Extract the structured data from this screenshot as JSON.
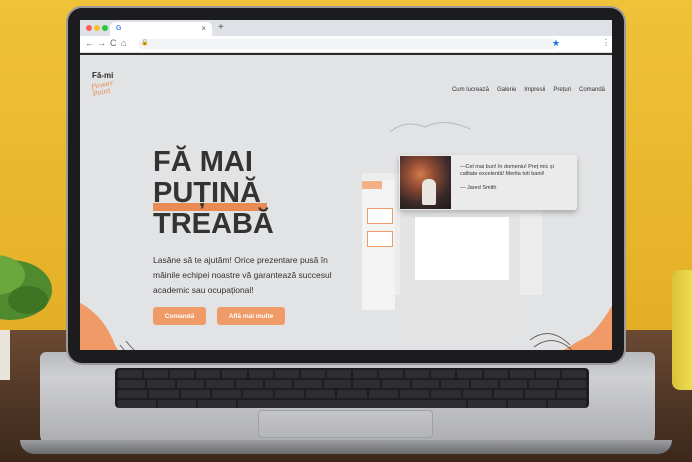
{
  "browser": {
    "tab_favicon": "G",
    "tab_close": "×",
    "new_tab": "+",
    "back": "←",
    "forward": "→",
    "reload": "C",
    "home": "⌂",
    "lock": "🔒",
    "bookmark": "★",
    "menu": "⋮"
  },
  "site": {
    "brand_name": "Fă-mi",
    "brand_tag_1": "Power",
    "brand_tag_2": "Point",
    "nav": [
      "Cum lucrează",
      "Galerie",
      "Impresii",
      "Prețuri",
      "Comandă"
    ],
    "hero_line1": "FĂ MAI",
    "hero_line2": "PUȚINĂ",
    "hero_line3": "TREABĂ",
    "description": "Lasăne să te ajutăm! Orice prezentare pusă în mâinile echipei noastre vă garantează succesul academic sau ocupațional!",
    "btn_primary": "Comandă",
    "btn_secondary": "Află mai multe",
    "testimonial_quote": "—Cel mai bun! în domeniu! Preț mic și calitate excelentă! Merita toti banii!",
    "testimonial_author": "— Jared Smith"
  },
  "colors": {
    "accent": "#ef9a67",
    "text": "#333333",
    "background": "#e2e3e5"
  }
}
